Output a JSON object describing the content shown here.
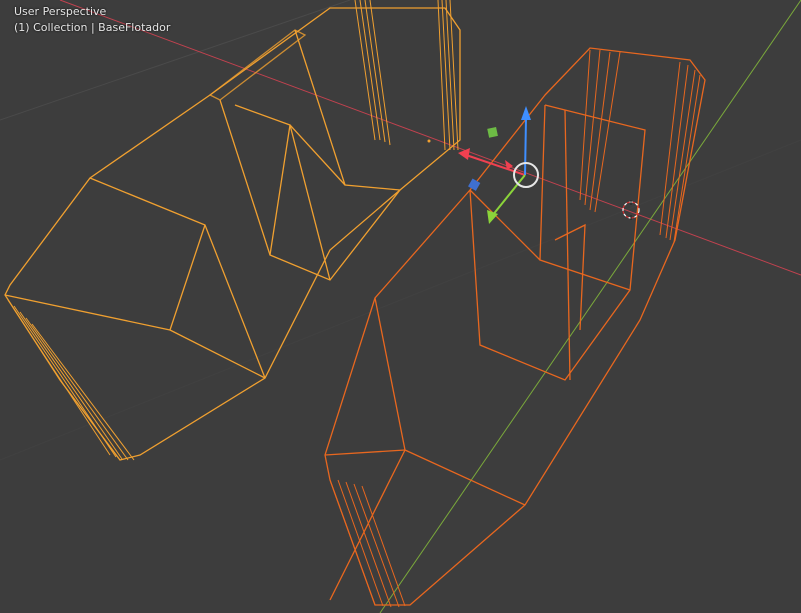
{
  "viewport": {
    "view_name": "User Perspective",
    "collection_label": "(1) Collection | BaseFlotador"
  },
  "colors": {
    "background": "#3d3d3d",
    "grid": "#4a4a4a",
    "x_axis": "#c2424f",
    "y_axis": "#7aa93b",
    "object_a_wire": "#f0a030",
    "object_b_wire": "#e8671f",
    "gizmo_x": "#f04050",
    "gizmo_y": "#8bd43a",
    "gizmo_z": "#3f8fff",
    "gizmo_center": "#e6e6e6"
  },
  "icons": {
    "transform_gizmo": "move-gizmo-icon",
    "cursor": "3d-cursor-icon"
  }
}
